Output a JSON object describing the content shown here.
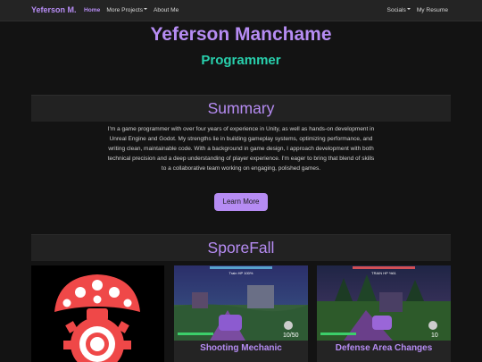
{
  "nav": {
    "brand": "Yeferson M.",
    "left_items": [
      {
        "label": "Home",
        "active": true
      },
      {
        "label": "More Projects",
        "dropdown": true
      },
      {
        "label": "About Me"
      }
    ],
    "right_items": [
      {
        "label": "Socials",
        "dropdown": true
      },
      {
        "label": "My Resume"
      }
    ]
  },
  "hero": {
    "name": "Yeferson Manchame",
    "role": "Programmer"
  },
  "summary": {
    "heading": "Summary",
    "text": "I'm a game programmer with over four years of experience in Unity, as well as hands-on development in Unreal Engine and Godot. My strengths lie in building gameplay systems, optimizing performance, and writing clean, maintainable code. With a background in game design, I approach development with both technical precision and a deep understanding of player experience. I'm eager to bring that blend of skills to a collaborative team working on engaging, polished games.",
    "button": "Learn More"
  },
  "sporefall": {
    "heading": "SporeFall",
    "cards": [
      {
        "title": "",
        "image": "sporefall-mushroom-logo"
      },
      {
        "title": "Shooting Mechanic",
        "image": "gameplay-screenshot",
        "hud_ammo": "10/50",
        "hud_top": "Train HP 100%"
      },
      {
        "title": "Defense Area Changes",
        "image": "gameplay-screenshot",
        "hud_ammo": "10",
        "hud_top": "TRAIN HP %61"
      }
    ]
  },
  "colors": {
    "accent": "#b68cf3",
    "teal": "#28d0ad",
    "background": "#131313",
    "panel": "#222222"
  }
}
